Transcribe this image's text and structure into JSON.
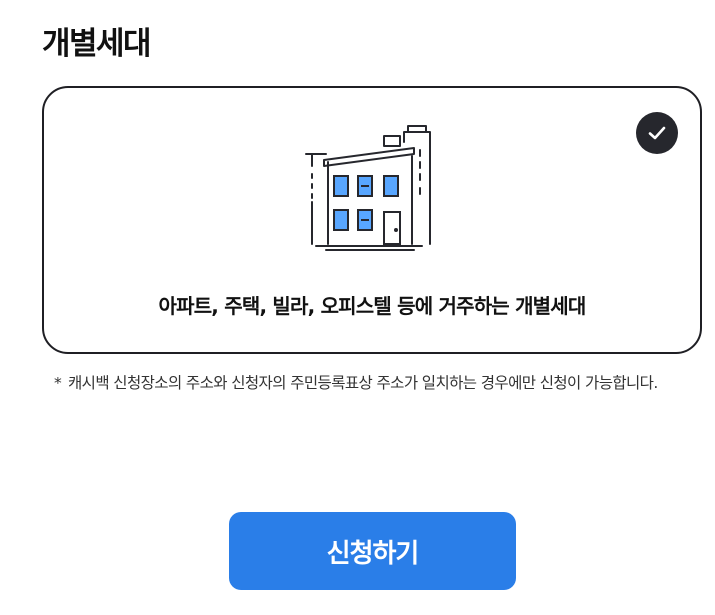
{
  "section": {
    "title": "개별세대"
  },
  "option_card": {
    "description": "아파트, 주택, 빌라, 오피스텔 등에 거주하는 개별세대",
    "selected": true,
    "illustration_icon": "building-icon",
    "check_icon": "check-icon"
  },
  "notice": {
    "mark": "*",
    "text": "캐시백 신청장소의 주소와 신청자의 주민등록표상 주소가 일치하는 경우에만 신청이 가능합니다."
  },
  "apply_button": {
    "label": "신청하기"
  },
  "colors": {
    "accent": "#2a7ee8",
    "card_border": "#1f1f24",
    "window_fill": "#58a6ff",
    "check_badge": "#26272d"
  }
}
